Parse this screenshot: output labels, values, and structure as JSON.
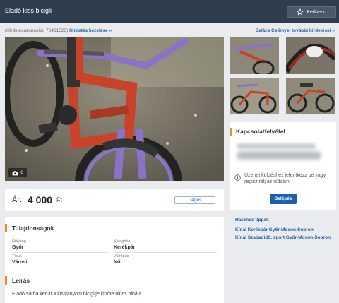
{
  "header": {
    "title": "Eladó kiss bicigli",
    "favorite_label": "Kedvenc",
    "favorite_icon": "star-outline-icon"
  },
  "meta": {
    "ad_id_text": "(Hirdetésazonosító: 76461523)",
    "manage_link": "Hirdetés kezelése »",
    "seller_link": "Balázs Csőmyei további hirdetései »"
  },
  "gallery": {
    "photo_count": "6",
    "camera_icon": "camera-icon"
  },
  "price": {
    "label": "Ár:",
    "value": "4 000",
    "currency": "Ft",
    "badge": "Céges"
  },
  "properties": {
    "title": "Tulajdonságok",
    "items": [
      {
        "label": "Helység",
        "value": "Győr"
      },
      {
        "label": "Kategória",
        "value": "Kerékpár"
      },
      {
        "label": "Típus",
        "value": "Városi"
      },
      {
        "label": "Váztípus",
        "value": "Női"
      }
    ]
  },
  "description": {
    "title": "Leírás",
    "text": "Eladó sorba került a kisslányom biciglije kinőte nincs hibája."
  },
  "contact": {
    "title": "Kapcsolatfelvétel",
    "info_text": "Üzenet küldéshez jelentkezz be vagy regisztrálj az oldalon.",
    "login_label": "Belépés"
  },
  "tips": {
    "title": "Hasznos tippek",
    "links": [
      "Kínál Kerékpár Győr-Moson-Sopron",
      "Kínál Szabadidő, sport Győr-Moson-Sopron"
    ]
  },
  "colors": {
    "header_bg": "#2f3e4e",
    "accent": "#f08a24",
    "link": "#1d5fa8"
  }
}
